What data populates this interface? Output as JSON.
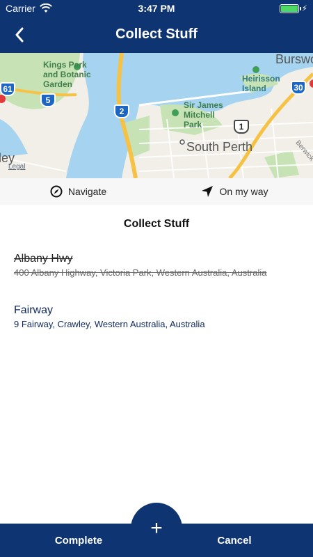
{
  "status_bar": {
    "carrier": "Carrier",
    "time": "3:47 PM",
    "battery_level": 1.0,
    "icons": [
      "wifi-icon",
      "battery-icon",
      "charging-bolt-icon"
    ]
  },
  "nav": {
    "title": "Collect Stuff",
    "back_icon": "chevron-left-icon",
    "background_color": "#0f3472"
  },
  "map": {
    "labels": {
      "kings_park": "Kings Park and Botanic Garden",
      "kings_park_l1": "Kings Park",
      "kings_park_l2": "and Botanic",
      "kings_park_l3": "Garden",
      "sir_james_l1": "Sir James",
      "sir_james_l2": "Mitchell",
      "sir_james_l3": "Park",
      "heirisson_l1": "Heirisson",
      "heirisson_l2": "Island",
      "south_perth": "South Perth",
      "crawley_partial": "ley",
      "burswood_partial": "Burswo",
      "berwick_partial": "Berwick",
      "legal": "Legal"
    },
    "route_shields": [
      "61",
      "5",
      "2",
      "1",
      "30"
    ]
  },
  "actions": {
    "navigate": "Navigate",
    "on_my_way": "On my way"
  },
  "section": {
    "title": "Collect Stuff"
  },
  "stops": [
    {
      "name": "Albany Hwy",
      "address": "400 Albany Highway, Victoria Park, Western Australia, Australia",
      "completed": true
    },
    {
      "name": "Fairway",
      "address": "9 Fairway, Crawley, Western Australia, Australia",
      "completed": false
    }
  ],
  "bottom": {
    "complete": "Complete",
    "cancel": "Cancel",
    "fab": "+"
  },
  "colors": {
    "brand": "#0f3472",
    "water": "#a5d3f0",
    "park": "#c7e2b5",
    "road_major": "#f6c245"
  }
}
